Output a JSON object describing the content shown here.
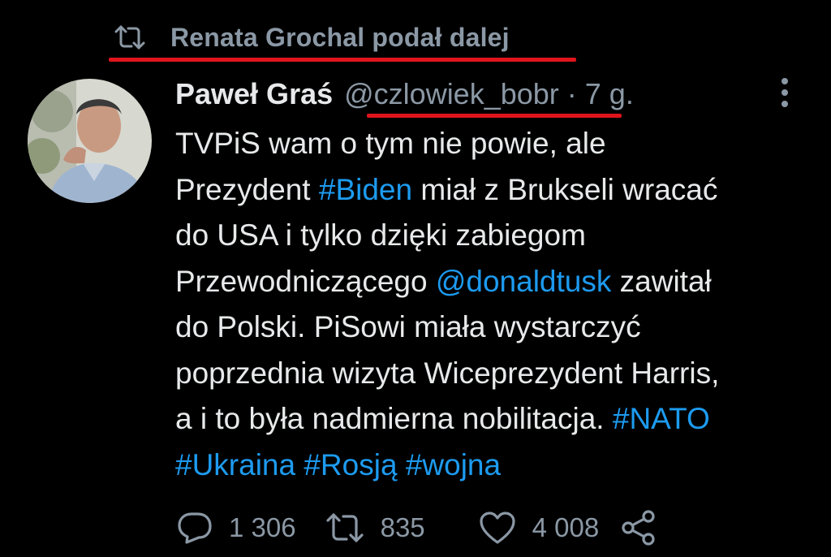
{
  "retweet": {
    "icon": "retweet-icon",
    "label": "Renata Grochal podał dalej"
  },
  "author": {
    "avatar_icon": "avatar-photo",
    "name": "Paweł Graś",
    "handle": "@czlowiek_bobr",
    "separator": "·",
    "time": "7 g."
  },
  "more_icon": "more-vertical-icon",
  "tweet": {
    "segments": [
      {
        "type": "text",
        "text": "TVPiS wam o tym nie powie, ale\nPrezydent "
      },
      {
        "type": "link",
        "text": "#Biden"
      },
      {
        "type": "text",
        "text": " miał z Brukseli wracać\ndo USA i tylko dzięki zabiegom\nPrzewodniczącego "
      },
      {
        "type": "link",
        "text": "@donaldtusk"
      },
      {
        "type": "text",
        "text": " zawitał\ndo Polski. PiSowi miała wystarczyć\npoprzednia wizyta Wiceprezydent Harris,\na i to była nadmierna nobilitacja. "
      },
      {
        "type": "link",
        "text": "#NATO"
      },
      {
        "type": "text",
        "text": "\n"
      },
      {
        "type": "link",
        "text": "#Ukraina"
      },
      {
        "type": "text",
        "text": " "
      },
      {
        "type": "link",
        "text": "#Rosją"
      },
      {
        "type": "text",
        "text": " "
      },
      {
        "type": "link",
        "text": "#wojna"
      }
    ]
  },
  "actions": {
    "reply": {
      "icon": "reply-icon",
      "count": "1 306"
    },
    "retweet": {
      "icon": "retweet-icon",
      "count": "835"
    },
    "like": {
      "icon": "heart-icon",
      "count": "4 008"
    },
    "share": {
      "icon": "share-icon"
    }
  },
  "colors": {
    "background": "#000000",
    "text": "#e7e9ea",
    "secondary": "#8b98a5",
    "link": "#1d9bf0",
    "annotation_red": "#e0141c"
  }
}
